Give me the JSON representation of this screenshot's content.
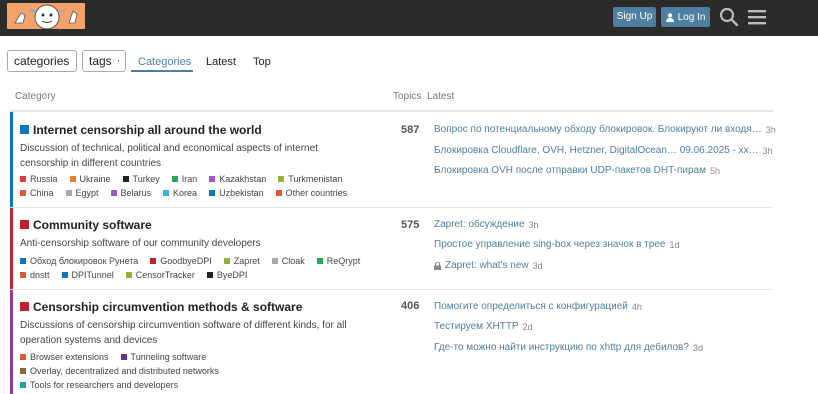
{
  "header": {
    "signup_label": "Sign Up",
    "login_label": "Log In"
  },
  "nav": {
    "categories_dropdown": "categories",
    "tags_dropdown": "tags",
    "tabs": [
      "Categories",
      "Latest",
      "Top"
    ]
  },
  "table": {
    "col_category": "Category",
    "col_topics": "Topics",
    "col_latest": "Latest"
  },
  "colors": {
    "brand": "#4e7fa0",
    "header_bg": "#2b2b2b"
  },
  "categories": [
    {
      "title": "Internet censorship all around the world",
      "color": "#0e76bd",
      "bar_color": "#0e76bd",
      "description": "Discussion of technical, political and economical aspects of internet censorship in different countries",
      "topics": "587",
      "subcategories": [
        {
          "name": "Russia",
          "color": "#e03a3a"
        },
        {
          "name": "Ukraine",
          "color": "#f07c2a"
        },
        {
          "name": "Turkey",
          "color": "#222222"
        },
        {
          "name": "Iran",
          "color": "#27a84a"
        },
        {
          "name": "Kazakhstan",
          "color": "#9b59d0"
        },
        {
          "name": "Turkmenistan",
          "color": "#8fb233"
        },
        {
          "name": "China",
          "color": "#e05a3a"
        },
        {
          "name": "Egypt",
          "color": "#aaaaaa"
        },
        {
          "name": "Belarus",
          "color": "#9b59d0"
        },
        {
          "name": "Korea",
          "color": "#3ab0e0"
        },
        {
          "name": "Uzbekistan",
          "color": "#0e76bd"
        },
        {
          "name": "Other countries",
          "color": "#e05a3a"
        }
      ],
      "latest": [
        {
          "title": "Вопрос по потенциальному обходу блокировок. Блокируют ли входя…",
          "age": "3h",
          "locked": false
        },
        {
          "title": "Блокировка Cloudflare, OVH, Hetzner, DigitalOcean… 09.06.2025 - xx…",
          "age": "3h",
          "locked": false
        },
        {
          "title": "Блокировка OVH после отправки UDP-пакетов DHT-пирам",
          "age": "5h",
          "locked": false
        }
      ]
    },
    {
      "title": "Community software",
      "color": "#c0222d",
      "bar_color": "#c0222d",
      "description": "Anti-censorship software of our community developers",
      "topics": "575",
      "subcategories": [
        {
          "name": "Обход блокировок Рунета",
          "color": "#0e76bd"
        },
        {
          "name": "GoodbyeDPI",
          "color": "#c0222d"
        },
        {
          "name": "Zapret",
          "color": "#8fb233"
        },
        {
          "name": "Cloak",
          "color": "#aaaaaa"
        },
        {
          "name": "ReQrypt",
          "color": "#27a84a"
        },
        {
          "name": "dnstt",
          "color": "#e05a3a"
        },
        {
          "name": "DPITunnel",
          "color": "#0e76bd"
        },
        {
          "name": "CensorTracker",
          "color": "#8fb233"
        },
        {
          "name": "ByeDPI",
          "color": "#222222"
        }
      ],
      "latest": [
        {
          "title": "Zapret: обсуждение",
          "age": "3h",
          "locked": false
        },
        {
          "title": "Простое управление sing-box через значок в трее",
          "age": "1d",
          "locked": false
        },
        {
          "title": "Zapret: what's new",
          "age": "3d",
          "locked": true
        }
      ]
    },
    {
      "title": "Censorship circumvention methods & software",
      "color": "#c0222d",
      "bar_color": "#8e3a9c",
      "description": "Discussions of censorship circumvention software of different kinds, for all operation systems and devices",
      "topics": "406",
      "subcategories": [
        {
          "name": "Browser extensions",
          "color": "#e05a3a"
        },
        {
          "name": "Tunneling software",
          "color": "#6b2f8e"
        },
        {
          "name": "Overlay, decentralized and distributed networks",
          "color": "#8a6a3a"
        },
        {
          "name": "Tools for researchers and developers",
          "color": "#17a6a0"
        }
      ],
      "latest": [
        {
          "title": "Помогите определиться с конфигурацией",
          "age": "4h",
          "locked": false
        },
        {
          "title": "Тестируем XHTTP",
          "age": "2d",
          "locked": false
        },
        {
          "title": "Где-то можно найти инструкцию по xhttp для дебилов?",
          "age": "3d",
          "locked": false
        }
      ]
    }
  ]
}
